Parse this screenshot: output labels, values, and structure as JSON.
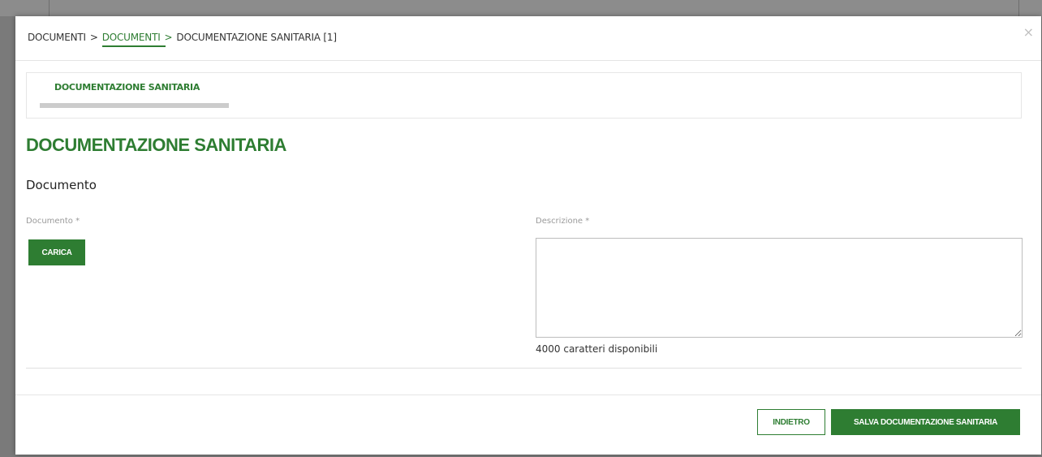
{
  "breadcrumb": {
    "item1": "DOCUMENTI",
    "sep1": ">",
    "item2": "DOCUMENTI",
    "sep2": ">",
    "item3": "DOCUMENTAZIONE SANITARIA [1]"
  },
  "close_label": "×",
  "tab": {
    "label": "DOCUMENTAZIONE SANITARIA"
  },
  "section_title": "DOCUMENTAZIONE SANITARIA",
  "subsection_title": "Documento",
  "fields": {
    "document_label": "Documento *",
    "upload_button": "CARICA",
    "description_label": "Descrizione *",
    "description_value": "",
    "char_count": "4000 caratteri disponibili"
  },
  "footer": {
    "back_button": "INDIETRO",
    "save_button": "SALVA DOCUMENTAZIONE SANITARIA"
  },
  "colors": {
    "accent": "#2e7d32",
    "backdrop": "#7a7a7a",
    "muted_label": "#9a9a9a"
  }
}
